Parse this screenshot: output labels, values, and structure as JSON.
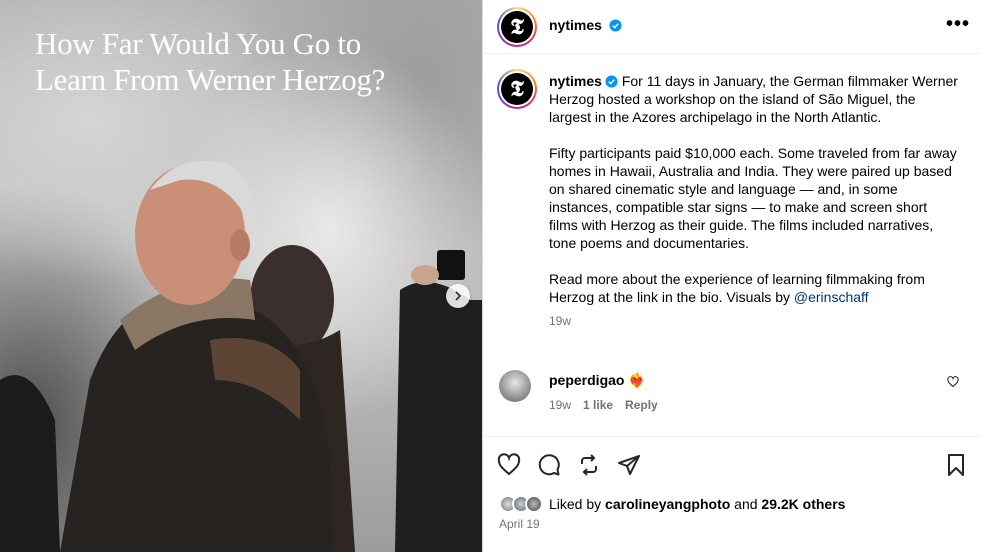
{
  "media": {
    "title_line1": "How Far Would You Go to",
    "title_line2": "Learn From Werner Herzog?",
    "next_icon": "chevron-right-icon"
  },
  "header": {
    "username": "nytimes",
    "verified_icon": "verified-badge-icon",
    "more_label": "•••"
  },
  "caption": {
    "username": "nytimes",
    "paragraph1": "For 11 days in January, the German filmmaker Werner Herzog hosted a workshop on the island of São Miguel, the largest in the Azores archipelago in the North Atlantic.",
    "paragraph2": "Fifty participants paid $10,000 each. Some traveled from far away homes in Hawaii, Australia and India. They were paired up based on shared cinematic style and language — and, in some instances, compatible star signs — to make and screen short films with Herzog as their guide. The films included narratives, tone poems and documentaries.",
    "paragraph3_text": "Read more about the experience of learning filmmaking from Herzog at the link in the bio. Visuals by ",
    "paragraph3_mention": "@erinschaff",
    "age": "19w"
  },
  "comment": {
    "username": "peperdigao",
    "emoji": "❤️‍🔥",
    "age": "19w",
    "likes": "1 like",
    "reply": "Reply"
  },
  "actions": {
    "like_icon": "heart-icon",
    "comment_icon": "comment-icon",
    "repost_icon": "repost-icon",
    "share_icon": "share-icon",
    "save_icon": "bookmark-icon"
  },
  "likes": {
    "prefix": "Liked by",
    "user": "carolineyangphoto",
    "conjunction": "and",
    "others": "29.2K others"
  },
  "date": "April 19",
  "colors": {
    "accent_blue": "#0095f6",
    "mention_blue": "#00376b",
    "secondary_text": "#737373"
  }
}
